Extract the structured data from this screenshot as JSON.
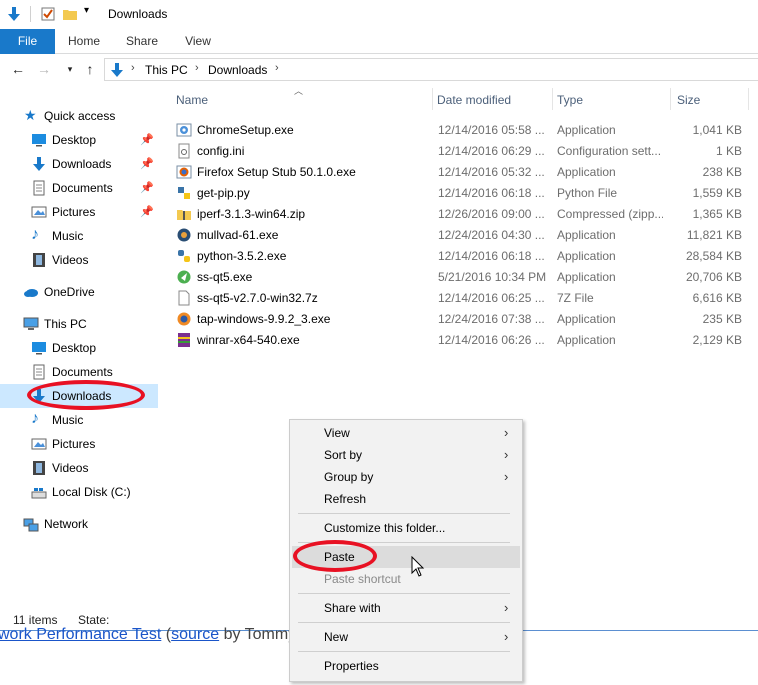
{
  "window": {
    "title": "Downloads"
  },
  "ribbon": {
    "tabs": [
      "File",
      "Home",
      "Share",
      "View"
    ]
  },
  "address": {
    "crumbs": [
      "This PC",
      "Downloads"
    ]
  },
  "nav": {
    "quick_access": "Quick access",
    "quick_items": [
      "Desktop",
      "Downloads",
      "Documents",
      "Pictures",
      "Music",
      "Videos"
    ],
    "onedrive": "OneDrive",
    "this_pc": "This PC",
    "pc_items": [
      "Desktop",
      "Documents",
      "Downloads",
      "Music",
      "Pictures",
      "Videos",
      "Local Disk (C:)"
    ],
    "network": "Network"
  },
  "columns": {
    "name": "Name",
    "date": "Date modified",
    "type": "Type",
    "size": "Size"
  },
  "files": [
    {
      "name": "ChromeSetup.exe",
      "date": "12/14/2016 05:58 ...",
      "type": "Application",
      "size": "1,041 KB",
      "icon": "chrome-setup-icon"
    },
    {
      "name": "config.ini",
      "date": "12/14/2016 06:29 ...",
      "type": "Configuration sett...",
      "size": "1 KB",
      "icon": "ini-file-icon"
    },
    {
      "name": "Firefox Setup Stub 50.1.0.exe",
      "date": "12/14/2016 05:32 ...",
      "type": "Application",
      "size": "238 KB",
      "icon": "firefox-icon"
    },
    {
      "name": "get-pip.py",
      "date": "12/14/2016 06:18 ...",
      "type": "Python File",
      "size": "1,559 KB",
      "icon": "python-file-icon"
    },
    {
      "name": "iperf-3.1.3-win64.zip",
      "date": "12/26/2016 09:00 ...",
      "type": "Compressed (zipp...",
      "size": "1,365 KB",
      "icon": "zip-folder-icon"
    },
    {
      "name": "mullvad-61.exe",
      "date": "12/24/2016 04:30 ...",
      "type": "Application",
      "size": "11,821 KB",
      "icon": "mullvad-icon"
    },
    {
      "name": "python-3.5.2.exe",
      "date": "12/14/2016 06:18 ...",
      "type": "Application",
      "size": "28,584 KB",
      "icon": "python-installer-icon"
    },
    {
      "name": "ss-qt5.exe",
      "date": "5/21/2016 10:34 PM",
      "type": "Application",
      "size": "20,706 KB",
      "icon": "shadowsocks-icon"
    },
    {
      "name": "ss-qt5-v2.7.0-win32.7z",
      "date": "12/14/2016 06:25 ...",
      "type": "7Z File",
      "size": "6,616 KB",
      "icon": "blank-file-icon"
    },
    {
      "name": "tap-windows-9.9.2_3.exe",
      "date": "12/24/2016 07:38 ...",
      "type": "Application",
      "size": "235 KB",
      "icon": "tap-windows-icon"
    },
    {
      "name": "winrar-x64-540.exe",
      "date": "12/14/2016 06:26 ...",
      "type": "Application",
      "size": "2,129 KB",
      "icon": "winrar-icon"
    }
  ],
  "status": {
    "count": "11 items",
    "state": "State:"
  },
  "behind_page": {
    "text_a": "work Performance Test",
    "text_b": " (",
    "text_c": "source",
    "text_d": " by Tommy Zi"
  },
  "context_menu": {
    "view": "View",
    "sort_by": "Sort by",
    "group_by": "Group by",
    "refresh": "Refresh",
    "customize": "Customize this folder...",
    "paste": "Paste",
    "paste_shortcut": "Paste shortcut",
    "share_with": "Share with",
    "new": "New",
    "properties": "Properties"
  },
  "colors": {
    "accent": "#1979ca",
    "selection": "#cce8ff",
    "annotation": "#e81123"
  }
}
